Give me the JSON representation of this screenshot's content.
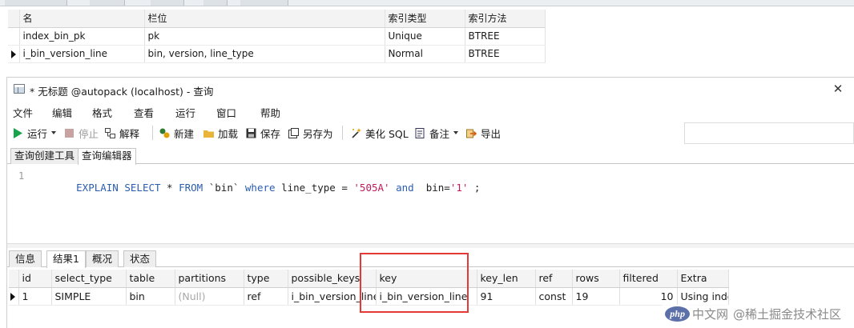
{
  "index_panel": {
    "headers": [
      "名",
      "栏位",
      "索引类型",
      "索引方法"
    ],
    "rows": [
      {
        "selected": false,
        "cells": [
          "index_bin_pk",
          "pk",
          "Unique",
          "BTREE"
        ]
      },
      {
        "selected": true,
        "cells": [
          "i_bin_version_line",
          "bin, version, line_type",
          "Normal",
          "BTREE"
        ]
      }
    ]
  },
  "window": {
    "title": "* 无标题 @autopack (localhost) - 查询",
    "close_glyph": "✕"
  },
  "menu": [
    "文件",
    "编辑",
    "格式",
    "查看",
    "运行",
    "窗口",
    "帮助"
  ],
  "toolbar": {
    "run": "运行",
    "stop": "停止",
    "explain": "解释",
    "new": "新建",
    "load": "加载",
    "save": "保存",
    "save_as": "另存为",
    "beautify": "美化 SQL",
    "note": "备注",
    "export": "导出"
  },
  "editor_tabs": [
    "查询创建工具",
    "查询编辑器"
  ],
  "editor": {
    "line_number": "1",
    "tokens": [
      {
        "t": "EXPLAIN",
        "c": "kw"
      },
      {
        "t": " ",
        "c": ""
      },
      {
        "t": "SELECT",
        "c": "kw"
      },
      {
        "t": " * ",
        "c": ""
      },
      {
        "t": "FROM",
        "c": "kw"
      },
      {
        "t": " `bin` ",
        "c": ""
      },
      {
        "t": "where",
        "c": "kw"
      },
      {
        "t": " line_type = ",
        "c": ""
      },
      {
        "t": "'505A'",
        "c": "str"
      },
      {
        "t": " ",
        "c": ""
      },
      {
        "t": "and",
        "c": "kw"
      },
      {
        "t": "  bin=",
        "c": ""
      },
      {
        "t": "'1'",
        "c": "str"
      },
      {
        "t": " ;",
        "c": ""
      }
    ]
  },
  "result_tabs": [
    "信息",
    "结果1",
    "概况",
    "状态"
  ],
  "result": {
    "headers": [
      "id",
      "select_type",
      "table",
      "partitions",
      "type",
      "possible_keys",
      "key",
      "key_len",
      "ref",
      "rows",
      "filtered",
      "Extra"
    ],
    "rows": [
      [
        "1",
        "SIMPLE",
        "bin",
        "(Null)",
        "ref",
        "i_bin_version_line",
        "i_bin_version_line",
        "91",
        "const",
        "19",
        "10",
        "Using index"
      ]
    ]
  },
  "watermark": {
    "logo": "php",
    "text": "中文网",
    "site": "@稀土掘金技术社区"
  },
  "colors": {
    "highlight": "#e53935",
    "keyword": "#2a5db0",
    "string": "#c2185b",
    "run_icon": "#1aa34a"
  }
}
